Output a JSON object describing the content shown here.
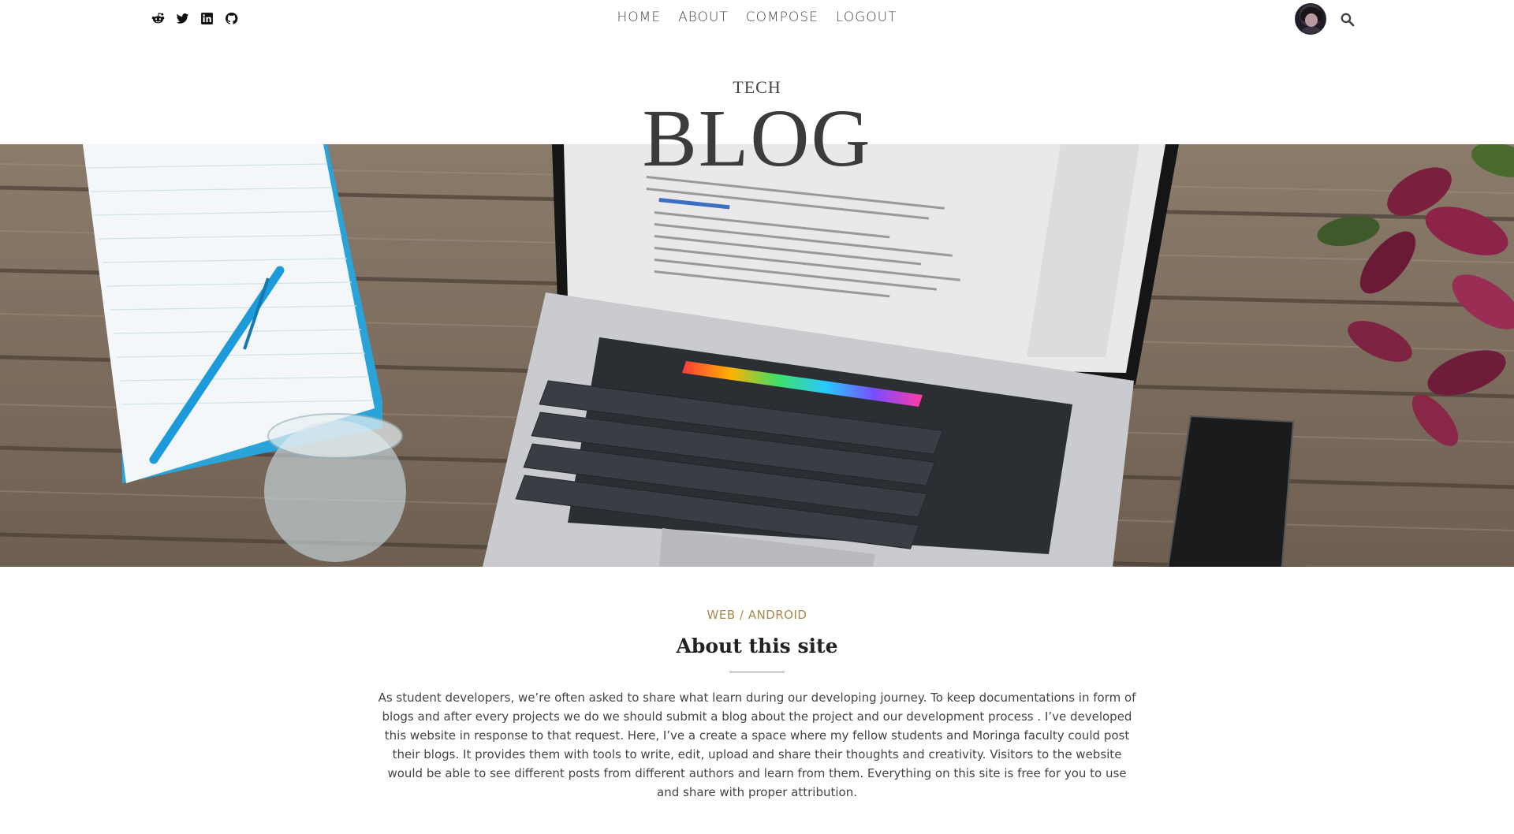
{
  "nav": {
    "links": [
      "HOME",
      "ABOUT",
      "COMPOSE",
      "LOGOUT"
    ]
  },
  "social": [
    "reddit-icon",
    "twitter-icon",
    "linkedin-icon",
    "github-icon"
  ],
  "header": {
    "eyebrow": "TECH",
    "title": "BLOG"
  },
  "post": {
    "category": "WEB / ANDROID",
    "title": "About this site",
    "body": "As student developers, we’re often asked to share what learn during our developing journey. To keep documentations in form of blogs and after every projects we do we should submit a blog about the project and our development process . I’ve developed this website in response to that request. Here, I’ve a create a space where my fellow students and Moringa faculty could post their blogs. It provides them with tools to write, edit, upload and share their thoughts and creativity. Visitors to the website would be able to see different posts from different authors and learn from them. Everything on this site is free for you to use and share with proper attribution."
  },
  "colors": {
    "accent": "#a58a4c",
    "text": "#444444",
    "heading": "#222222"
  }
}
